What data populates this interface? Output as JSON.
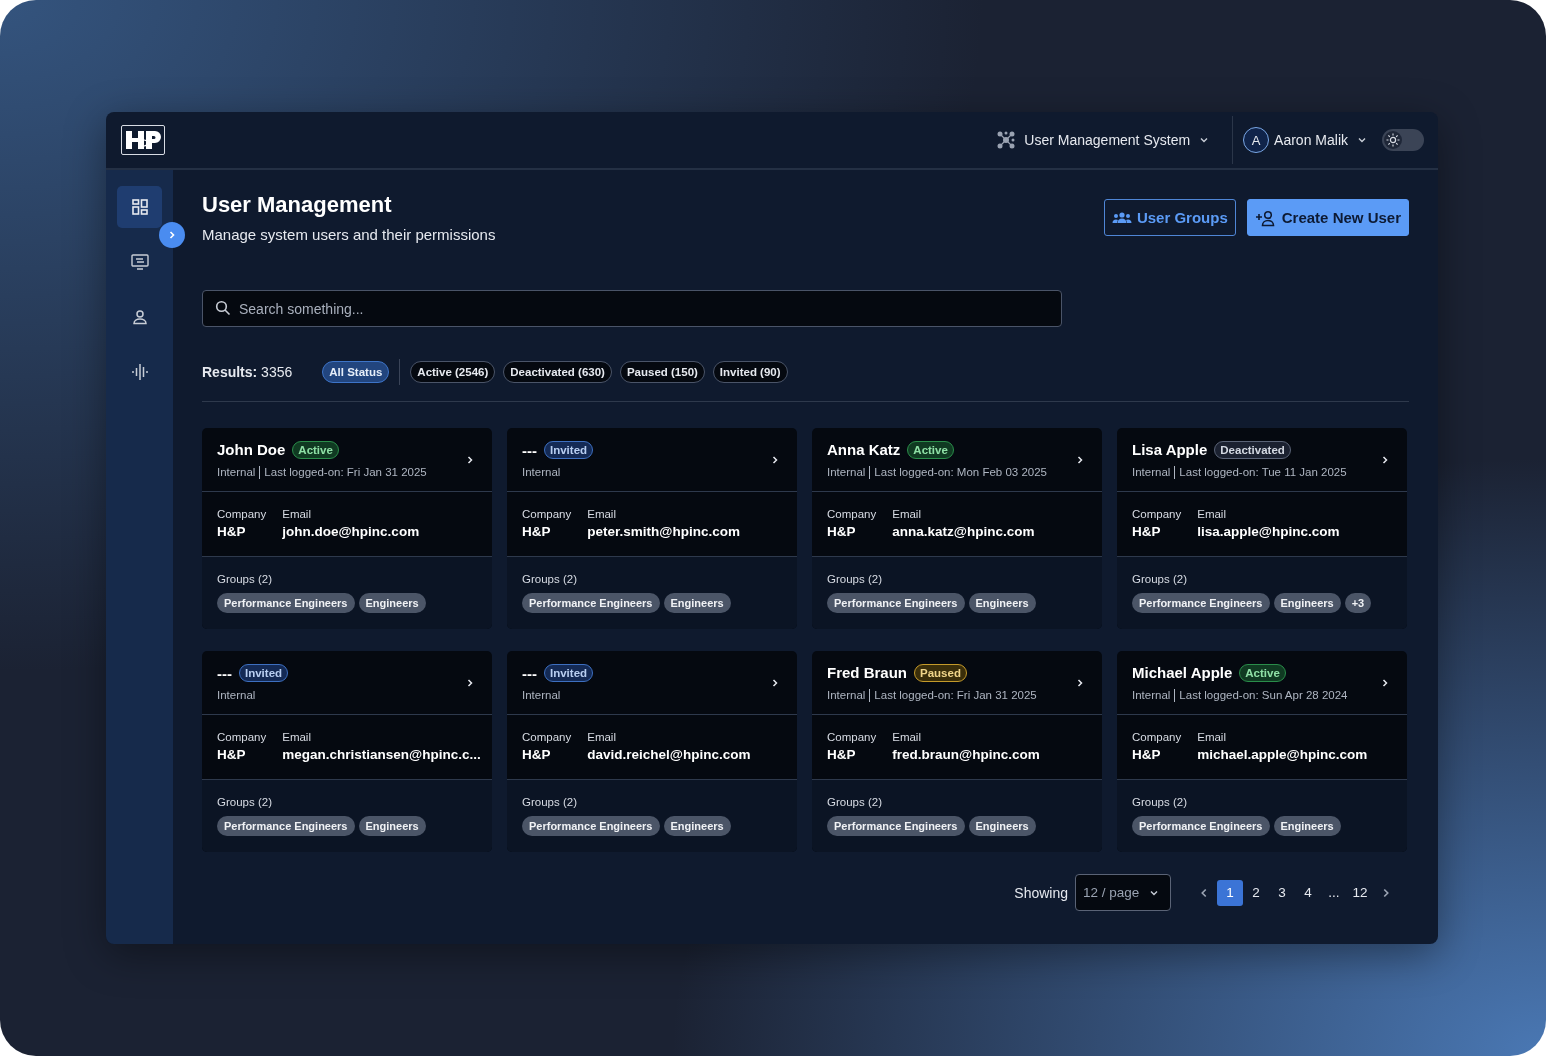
{
  "header": {
    "system": "User Management System",
    "user": {
      "initial": "A",
      "name": "Aaron Malik"
    },
    "theme_toggle": {
      "on": false
    }
  },
  "sidebar": {
    "items": [
      {
        "kind": "dashboard",
        "selected": true
      },
      {
        "kind": "screen",
        "selected": false
      },
      {
        "kind": "user",
        "selected": false
      },
      {
        "kind": "audio",
        "selected": false
      }
    ]
  },
  "page": {
    "title": "User Management",
    "subtitle": "Manage system users and their permissions",
    "buttons": [
      {
        "kind": "outline",
        "label": "User Groups"
      },
      {
        "kind": "primary",
        "label": "Create New User"
      }
    ]
  },
  "search": {
    "placeholder": "Search something..."
  },
  "results": {
    "label": "Results:",
    "count": "3356"
  },
  "filters": [
    {
      "label": "All Status",
      "selected": true
    },
    {
      "label": "Active (2546)",
      "selected": false
    },
    {
      "label": "Deactivated (630)",
      "selected": false
    },
    {
      "label": "Paused (150)",
      "selected": false
    },
    {
      "label": "Invited (90)",
      "selected": false
    }
  ],
  "cards": [
    {
      "name": "John Doe",
      "badge": {
        "label": "Active",
        "kind": "active"
      },
      "type": "Internal",
      "last_login": "Last logged-on: Fri Jan 31 2025",
      "company_label": "Company",
      "company": "H&P",
      "email_label": "Email",
      "email": "john.doe@hpinc.com",
      "groups_label": "Groups (2)",
      "groups": [
        "Performance Engineers",
        "Engineers"
      ]
    },
    {
      "name": "---",
      "badge": {
        "label": "Invited",
        "kind": "invited"
      },
      "type": "Internal",
      "company_label": "Company",
      "company": "H&P",
      "email_label": "Email",
      "email": "peter.smith@hpinc.com",
      "groups_label": "Groups (2)",
      "groups": [
        "Performance Engineers",
        "Engineers"
      ]
    },
    {
      "name": "Anna Katz",
      "badge": {
        "label": "Active",
        "kind": "active"
      },
      "type": "Internal",
      "last_login": "Last logged-on: Mon Feb 03 2025",
      "company_label": "Company",
      "company": "H&P",
      "email_label": "Email",
      "email": "anna.katz@hpinc.com",
      "groups_label": "Groups (2)",
      "groups": [
        "Performance Engineers",
        "Engineers"
      ]
    },
    {
      "name": "Lisa Apple",
      "badge": {
        "label": "Deactivated",
        "kind": "deactivated"
      },
      "type": "Internal",
      "last_login": "Last logged-on: Tue 11 Jan 2025",
      "company_label": "Company",
      "company": "H&P",
      "email_label": "Email",
      "email": "lisa.apple@hpinc.com",
      "groups_label": "Groups (2)",
      "groups": [
        "Performance Engineers",
        "Engineers",
        "+3"
      ]
    },
    {
      "name": "---",
      "badge": {
        "label": "Invited",
        "kind": "invited"
      },
      "type": "Internal",
      "company_label": "Company",
      "company": "H&P",
      "email_label": "Email",
      "email": "megan.christiansen@hpinc.c...",
      "groups_label": "Groups (2)",
      "groups": [
        "Performance Engineers",
        "Engineers"
      ]
    },
    {
      "name": "---",
      "badge": {
        "label": "Invited",
        "kind": "invited"
      },
      "type": "Internal",
      "company_label": "Company",
      "company": "H&P",
      "email_label": "Email",
      "email": "david.reichel@hpinc.com",
      "groups_label": "Groups (2)",
      "groups": [
        "Performance Engineers",
        "Engineers"
      ]
    },
    {
      "name": "Fred Braun",
      "badge": {
        "label": "Paused",
        "kind": "paused"
      },
      "type": "Internal",
      "last_login": "Last logged-on: Fri Jan 31 2025",
      "company_label": "Company",
      "company": "H&P",
      "email_label": "Email",
      "email": "fred.braun@hpinc.com",
      "groups_label": "Groups (2)",
      "groups": [
        "Performance Engineers",
        "Engineers"
      ]
    },
    {
      "name": "Michael Apple",
      "badge": {
        "label": "Active",
        "kind": "active"
      },
      "type": "Internal",
      "last_login": "Last logged-on: Sun Apr 28 2024",
      "company_label": "Company",
      "company": "H&P",
      "email_label": "Email",
      "email": "michael.apple@hpinc.com",
      "groups_label": "Groups (2)",
      "groups": [
        "Performance Engineers",
        "Engineers"
      ]
    }
  ],
  "pagination": {
    "showing": "Showing",
    "page_size": "12 / page",
    "pages": [
      {
        "label": "1",
        "selected": true
      },
      {
        "label": "2",
        "selected": false
      },
      {
        "label": "3",
        "selected": false
      },
      {
        "label": "4",
        "selected": false
      },
      {
        "label": "...",
        "selected": false
      },
      {
        "label": "12",
        "selected": false
      }
    ]
  }
}
